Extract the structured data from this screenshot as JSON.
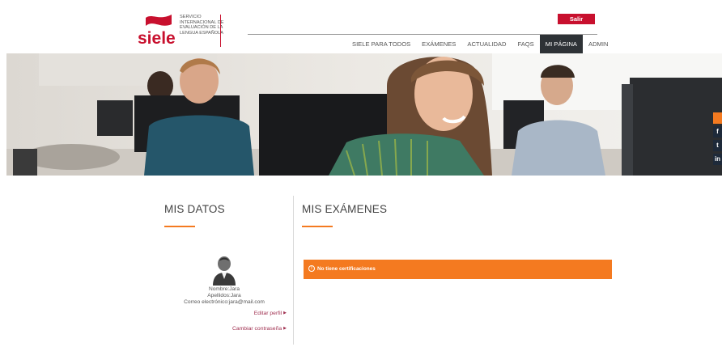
{
  "header": {
    "logo_text": "siele",
    "logo_subtitle": "SERVICIO INTERNACIONAL DE EVALUACIÓN DE LA LENGUA ESPAÑOLA",
    "logout_label": "Salir",
    "nav": [
      {
        "label": "SIELE PARA TODOS",
        "active": false
      },
      {
        "label": "EXÁMENES",
        "active": false
      },
      {
        "label": "ACTUALIDAD",
        "active": false
      },
      {
        "label": "FAQS",
        "active": false
      },
      {
        "label": "MI PÁGINA",
        "active": true
      },
      {
        "label": "ADMIN",
        "active": false
      }
    ]
  },
  "social": [
    {
      "icon": "rss-icon",
      "glyph": "",
      "color": "#f47a20"
    },
    {
      "icon": "facebook-icon",
      "glyph": "f",
      "color": "#1e2a3a"
    },
    {
      "icon": "twitter-icon",
      "glyph": "t",
      "color": "#1e2a3a"
    },
    {
      "icon": "linkedin-icon",
      "glyph": "in",
      "color": "#1e2a3a"
    }
  ],
  "profile": {
    "section_title": "MIS DATOS",
    "name_line": "Nombre:Jara",
    "surname_line": "Apellidos:Jara",
    "email_line": "Correo electrónico:jara@mail.com",
    "edit_profile": "Editar perfil",
    "change_password": "Cambiar contraseña"
  },
  "exams": {
    "section_title": "MIS EXÁMENES",
    "alert_text": "No tiene certificaciones",
    "alert_icon": "info-icon"
  },
  "colors": {
    "brand_red": "#c8102e",
    "accent_orange": "#f47a20",
    "nav_active": "#2e3236"
  }
}
